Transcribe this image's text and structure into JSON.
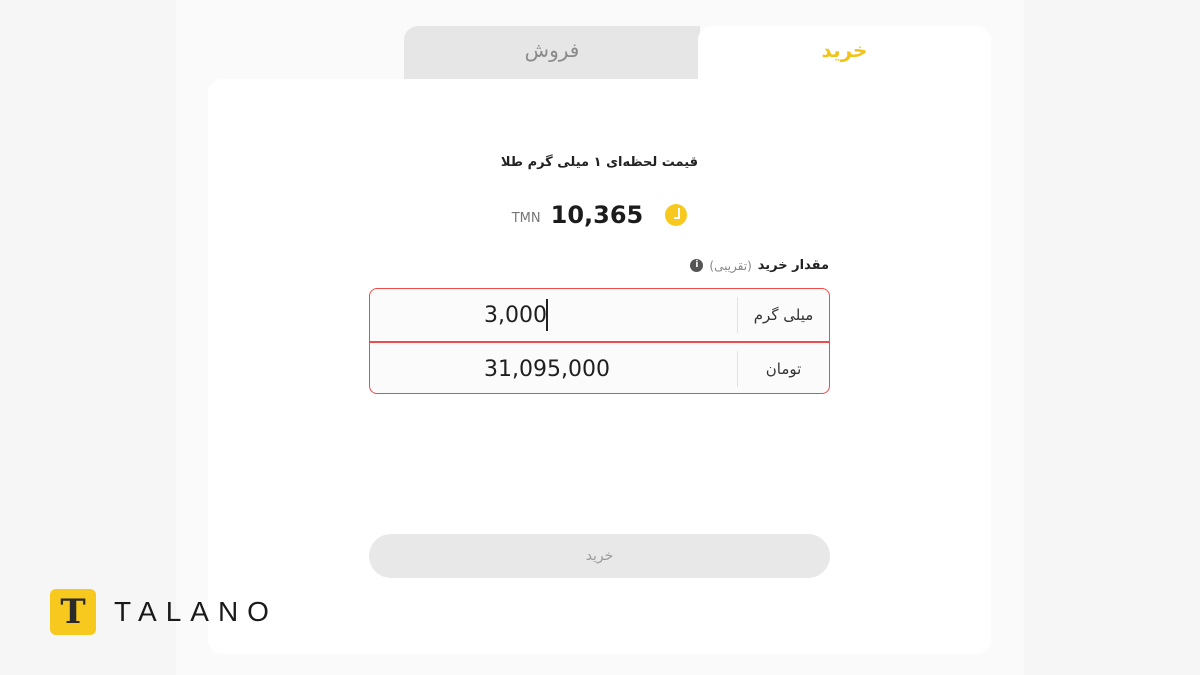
{
  "tabs": {
    "buy_label": "خرید",
    "sell_label": "فروش",
    "active": "buy"
  },
  "price": {
    "label": "قیمت لحظه‌ای ۱ میلی گرم طلا",
    "value": "10,365",
    "unit": "TMN",
    "icon": "coin-clock-icon"
  },
  "amount": {
    "label": "مقدار خرید",
    "note": "(تقریبی)",
    "info_icon": "i"
  },
  "fields": {
    "milligram": {
      "value": "3,000",
      "unit": "میلی گرم"
    },
    "toman": {
      "value": "31,095,000",
      "unit": "تومان"
    }
  },
  "submit_label": "خرید",
  "brand": {
    "mark": "T",
    "name": "TALANO"
  },
  "colors": {
    "accent": "#f7c81e",
    "error_border": "#ef4b4b"
  }
}
